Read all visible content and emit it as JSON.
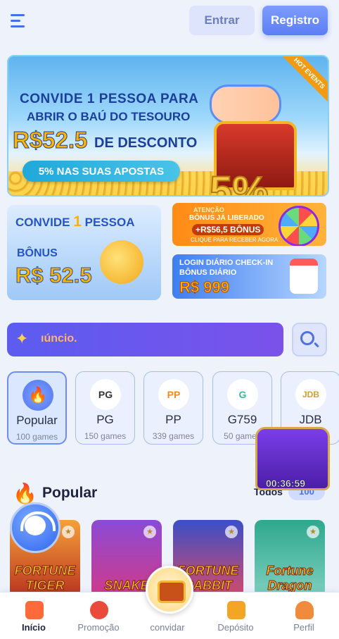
{
  "header": {
    "login_label": "Entrar",
    "register_label": "Registro"
  },
  "banner_main": {
    "badge": "HOT EVENTS",
    "line1": "CONVIDE 1 PESSOA PARA",
    "line2": "ABRIR O BAÚ DO TESOURO",
    "price": "R$52.5",
    "desc": "DE DESCONTO",
    "pill": "5% NAS SUAS APOSTAS",
    "big": "5%"
  },
  "card_left": {
    "title_prefix": "CONVIDE",
    "title_num": "1",
    "title_suffix": "PESSOA",
    "label": "BÔNUS",
    "amount": "R$ 52.5"
  },
  "card_right_top": {
    "line1": "ATENÇÃO",
    "line2": "BÔNUS JÁ LIBERADO",
    "amount": "+R$56,5  BÔNUS",
    "cta": "CLIQUE PARA RECEBER AGORA"
  },
  "card_right_bottom": {
    "line1": "LOGIN DIÁRIO CHECK-IN",
    "line2": "BÔNUS DIÁRIO",
    "amount": "R$ 999"
  },
  "marquee": {
    "text": "ıúncio."
  },
  "providers": [
    {
      "name": "Popular",
      "count": "100 games",
      "logo": "🔥"
    },
    {
      "name": "PG",
      "count": "150 games",
      "logo": "PG"
    },
    {
      "name": "PP",
      "count": "339 games",
      "logo": "PP"
    },
    {
      "name": "G759",
      "count": "50 games",
      "logo": "G"
    },
    {
      "name": "JDB",
      "count": "",
      "logo": "JDB"
    }
  ],
  "section": {
    "title": "Popular",
    "all_label": "Todos",
    "all_count": "100"
  },
  "floating_chest": {
    "timer": "00:36:59"
  },
  "games": [
    {
      "name": "FORTUNE TIGER",
      "colors": [
        "#f5a03a",
        "#b8331f"
      ]
    },
    {
      "name": "SNAKE",
      "colors": [
        "#8b4ad6",
        "#d23a88"
      ]
    },
    {
      "name": "FORTUNE RABBIT",
      "colors": [
        "#3a4fc8",
        "#d74b6a"
      ]
    },
    {
      "name": "Fortune Dragon",
      "colors": [
        "#2ea88d",
        "#7fd0c0"
      ]
    }
  ],
  "nav": [
    {
      "label": "Início",
      "active": true,
      "color": "#ff6a3a"
    },
    {
      "label": "Promoção",
      "active": false,
      "color": "#e84b3a"
    },
    {
      "label": "convidar",
      "active": false,
      "color": "#ffffff"
    },
    {
      "label": "Depósito",
      "active": false,
      "color": "#f2a623"
    },
    {
      "label": "Perfil",
      "active": false,
      "color": "#f08a3c"
    }
  ]
}
